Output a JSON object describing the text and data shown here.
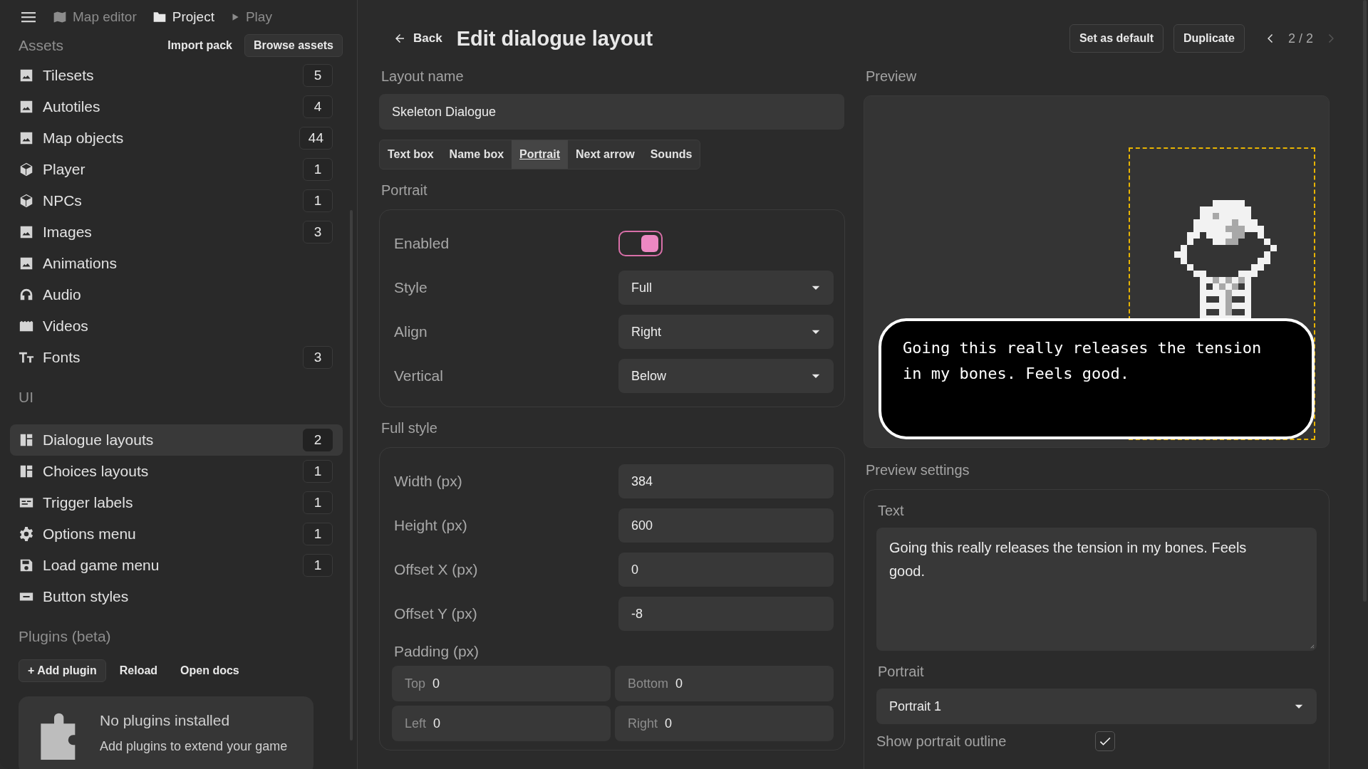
{
  "top_nav": {
    "items": [
      {
        "label": "Map editor",
        "selected": false
      },
      {
        "label": "Project",
        "selected": true
      },
      {
        "label": "Play",
        "selected": false
      }
    ]
  },
  "sidebar": {
    "sections": [
      {
        "title": "Assets",
        "actions": [
          {
            "label": "Import pack",
            "kind": "plain"
          },
          {
            "label": "Browse assets",
            "kind": "filled"
          }
        ],
        "items": [
          {
            "kind": "image",
            "label": "Tilesets",
            "count": "5",
            "selected": false
          },
          {
            "kind": "image",
            "label": "Autotiles",
            "count": "4",
            "selected": false
          },
          {
            "kind": "image",
            "label": "Map objects",
            "count": "44",
            "selected": false
          },
          {
            "kind": "cube",
            "label": "Player",
            "count": "1",
            "selected": false
          },
          {
            "kind": "cube",
            "label": "NPCs",
            "count": "1",
            "selected": false
          },
          {
            "kind": "image",
            "label": "Images",
            "count": "3",
            "selected": false
          },
          {
            "kind": "image",
            "label": "Animations",
            "selected": false
          },
          {
            "kind": "headphones",
            "label": "Audio",
            "selected": false
          },
          {
            "kind": "film",
            "label": "Videos",
            "selected": false
          },
          {
            "kind": "font",
            "label": "Fonts",
            "count": "3",
            "selected": false
          }
        ]
      },
      {
        "title": "UI",
        "items": [
          {
            "kind": "layout",
            "label": "Dialogue layouts",
            "count": "2",
            "selected": true
          },
          {
            "kind": "layout",
            "label": "Choices layouts",
            "count": "1",
            "selected": false
          },
          {
            "kind": "label",
            "label": "Trigger labels",
            "count": "1",
            "selected": false
          },
          {
            "kind": "gear",
            "label": "Options menu",
            "count": "1",
            "selected": false
          },
          {
            "kind": "save",
            "label": "Load game menu",
            "count": "1",
            "selected": false
          },
          {
            "kind": "button",
            "label": "Button styles",
            "selected": false
          }
        ]
      },
      {
        "title": "Plugins (beta)",
        "actions": [
          {
            "label": "+ Add plugin",
            "kind": "filled"
          },
          {
            "label": "Reload",
            "kind": "plain"
          },
          {
            "label": "Open docs",
            "kind": "plain"
          }
        ],
        "empty": {
          "title": "No plugins installed",
          "text": "Add plugins to extend your game"
        }
      }
    ]
  },
  "header": {
    "back": "Back",
    "title": "Edit dialogue layout",
    "buttons": [
      "Set as default",
      "Duplicate"
    ],
    "pager": {
      "text": "2 / 2",
      "prev_disabled": false,
      "next_disabled": true
    }
  },
  "editor": {
    "name_field": {
      "label": "Layout name",
      "value": "Skeleton Dialogue"
    },
    "tabs": [
      {
        "label": "Text box",
        "selected": false
      },
      {
        "label": "Name box",
        "selected": false
      },
      {
        "label": "Portrait",
        "selected": true
      },
      {
        "label": "Next arrow",
        "selected": false
      },
      {
        "label": "Sounds",
        "selected": false
      }
    ],
    "portrait": {
      "title": "Portrait",
      "rows": [
        {
          "kind": "toggle",
          "label": "Enabled",
          "on": true
        },
        {
          "kind": "select",
          "label": "Style",
          "value": "Full"
        },
        {
          "kind": "select",
          "label": "Align",
          "value": "Right"
        },
        {
          "kind": "select",
          "label": "Vertical",
          "value": "Below"
        }
      ]
    },
    "full_style": {
      "title": "Full style",
      "rows": [
        {
          "kind": "input",
          "label": "Width (px)",
          "value": "384"
        },
        {
          "kind": "input",
          "label": "Height (px)",
          "value": "600"
        },
        {
          "kind": "input",
          "label": "Offset X (px)",
          "value": "0"
        },
        {
          "kind": "input",
          "label": "Offset Y (px)",
          "value": "-8"
        }
      ],
      "padding": {
        "label": "Padding (px)",
        "fields": [
          {
            "label": "Top",
            "value": "0"
          },
          {
            "label": "Bottom",
            "value": "0"
          },
          {
            "label": "Left",
            "value": "0"
          },
          {
            "label": "Right",
            "value": "0"
          }
        ]
      }
    }
  },
  "preview": {
    "title": "Preview",
    "dialogue_text": "Going this really releases the tension in my bones. Feels good."
  },
  "preview_settings": {
    "title": "Preview settings",
    "text": {
      "label": "Text",
      "value": "Going this really releases the tension in my bones. Feels good."
    },
    "portrait": {
      "label": "Portrait",
      "value": "Portrait 1"
    },
    "outline": {
      "label": "Show portrait outline",
      "checked": true
    }
  }
}
